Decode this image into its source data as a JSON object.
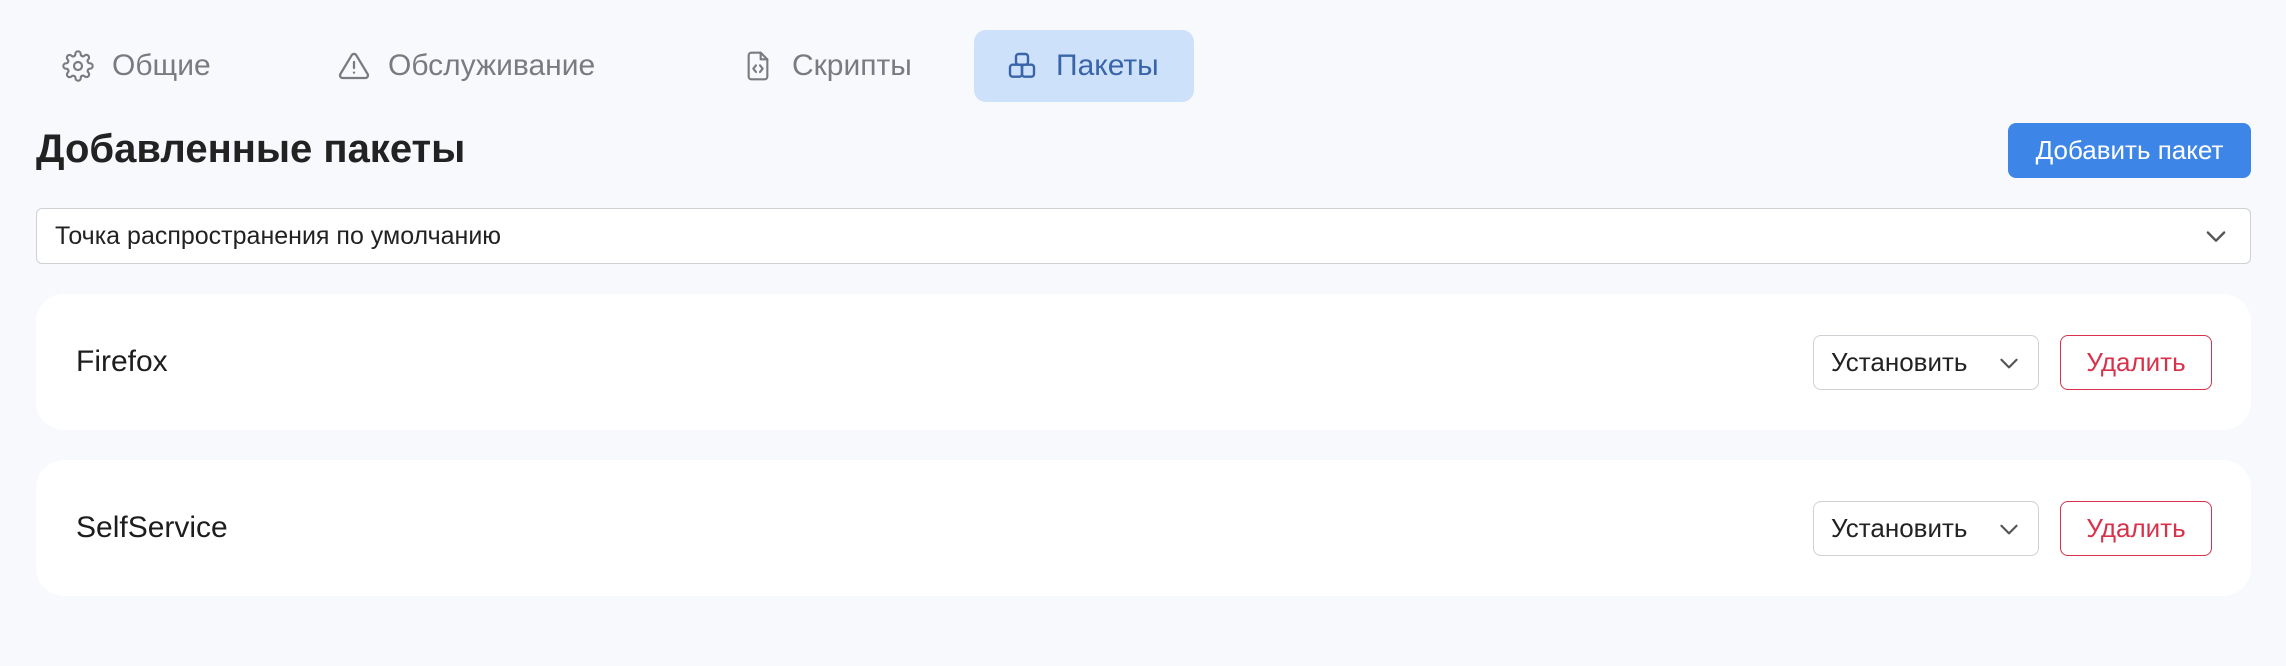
{
  "tabs": [
    {
      "label": "Общие",
      "icon": "gear-icon",
      "active": false
    },
    {
      "label": "Обслуживание",
      "icon": "warning-icon",
      "active": false
    },
    {
      "label": "Скрипты",
      "icon": "code-file-icon",
      "active": false
    },
    {
      "label": "Пакеты",
      "icon": "package-icon",
      "active": true
    }
  ],
  "header": {
    "title": "Добавленные пакеты",
    "add_button_label": "Добавить пакет"
  },
  "distribution_point": {
    "selected": "Точка распространения по умолчанию"
  },
  "packages": [
    {
      "name": "Firefox",
      "action": "Установить",
      "delete_label": "Удалить"
    },
    {
      "name": "SelfService",
      "action": "Установить",
      "delete_label": "Удалить"
    }
  ],
  "colors": {
    "background": "#f8f9fd",
    "accent": "#3d86e8",
    "active_tab_bg": "#cde1fb",
    "active_tab_text": "#3a64a8",
    "danger": "#d8314b"
  }
}
